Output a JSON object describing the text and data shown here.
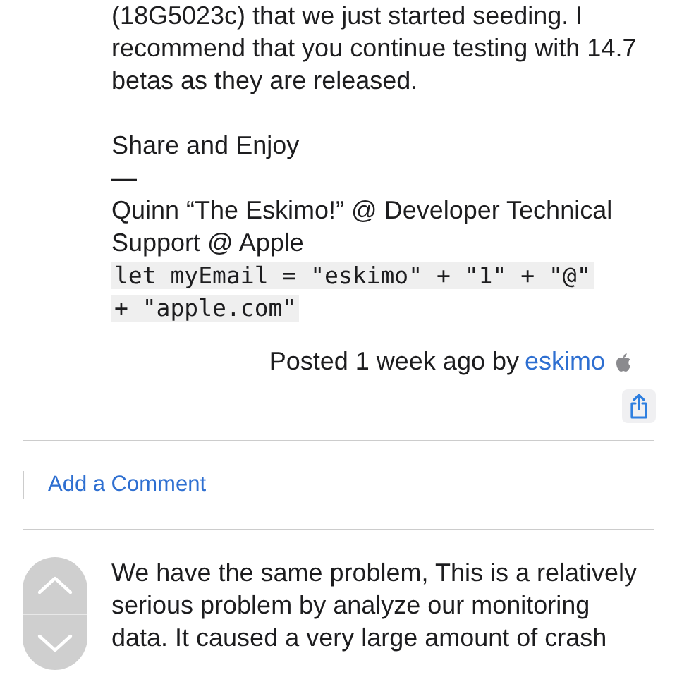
{
  "post": {
    "paragraphs": [
      {
        "lines": [
          "(18G5023c) that we just started seeding. I",
          "recommend that you continue testing with 14.7",
          "betas as they are released."
        ]
      },
      {
        "lines": [
          "Share and Enjoy",
          "—",
          "Quinn “The Eskimo!” @ Developer Technical",
          "Support @ Apple"
        ]
      }
    ],
    "code_lines": [
      "let myEmail = \"eskimo\" + \"1\" + \"@\"",
      "+ \"apple.com\""
    ],
    "posted": {
      "text": "Posted 1 week ago by",
      "author": "eskimo"
    }
  },
  "add_comment": "Add a Comment",
  "reply": {
    "lines": [
      "We have the same problem, This is a relatively",
      "serious problem by analyze our monitoring",
      "data. It caused a very large amount of crash"
    ]
  }
}
